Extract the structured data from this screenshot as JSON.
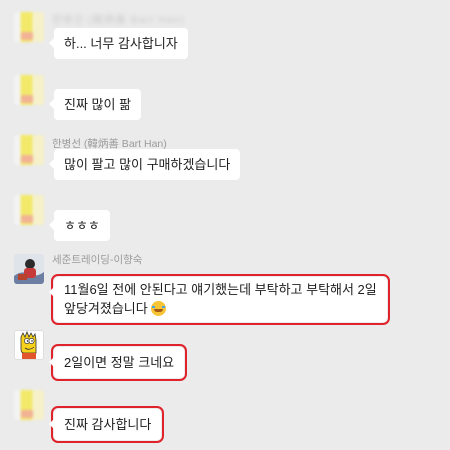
{
  "messages": [
    {
      "name": "한병선 (韓炳善 Bart Han)",
      "text": "하... 너무 감사합니자"
    },
    {
      "name": "",
      "text": "진짜 많이 팖"
    },
    {
      "name": "한병선 (韓炳善 Bart Han)",
      "text": "많이 팔고 많이 구매하겠습니다"
    },
    {
      "name": "",
      "text": "ㅎㅎㅎ"
    },
    {
      "name": "세준트레이딩-이향숙",
      "line1": "11월6일 전에 안된다고 얘기했는데 부탁하고 부탁해서 2일",
      "line2": "앞당겨졌습니다",
      "emoji": "laughing-tears-emoji"
    },
    {
      "name": "",
      "text": "2일이면 정말 크네요"
    },
    {
      "name": "",
      "text": "진짜 감사합니다"
    }
  ]
}
